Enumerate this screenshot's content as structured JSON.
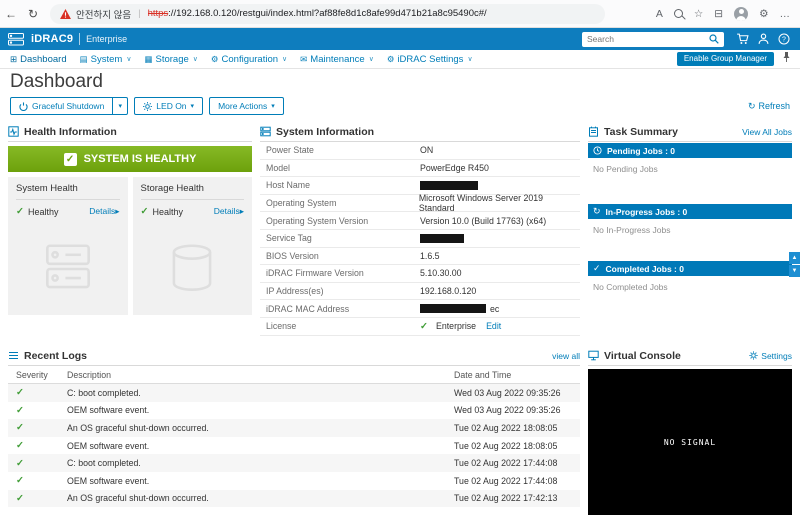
{
  "colors": {
    "accent": "#007db8",
    "header_blue": "#0e7dbe",
    "health_green": "#76aa17",
    "job_bar_blue": "#0079b8"
  },
  "glyphs": {
    "back": "←",
    "reload": "↻",
    "caret": "▾",
    "chevron": "∨",
    "check": "✓",
    "details_arrow": "▸",
    "refresh": "↻",
    "dashboard": "⊞",
    "system": "▤",
    "storage": "▦",
    "configuration": "⚙",
    "maintenance": "✉",
    "idrac_settings": "⚙",
    "scroll_up": "▲",
    "scroll_down": "▼"
  },
  "browser": {
    "warning_text": "안전하지 않음",
    "url_scheme": "https",
    "url_rest": "://192.168.0.120/restgui/index.html?af88fe8d1c8afe99d471b21a8c95490c#/",
    "right_icons": {
      "read_aloud": "A",
      "favorites": "☆",
      "collections": "⊟",
      "settings": "⚙",
      "more": "…"
    }
  },
  "header": {
    "product": "iDRAC9",
    "edition": "Enterprise",
    "search_placeholder": "Search"
  },
  "nav": {
    "items": [
      {
        "label": "Dashboard"
      },
      {
        "label": "System"
      },
      {
        "label": "Storage"
      },
      {
        "label": "Configuration"
      },
      {
        "label": "Maintenance"
      },
      {
        "label": "iDRAC Settings"
      }
    ],
    "group_manager_label": "Enable Group Manager"
  },
  "page": {
    "title": "Dashboard",
    "refresh_label": "Refresh"
  },
  "actions": {
    "graceful_shutdown": "Graceful Shutdown",
    "led": "LED On",
    "more_actions": "More Actions"
  },
  "health": {
    "panel_title": "Health Information",
    "banner": "SYSTEM IS HEALTHY",
    "cards": [
      {
        "title": "System Health",
        "status": "Healthy",
        "details_label": "Details"
      },
      {
        "title": "Storage Health",
        "status": "Healthy",
        "details_label": "Details"
      }
    ]
  },
  "system_info": {
    "panel_title": "System Information",
    "rows": [
      {
        "label": "Power State",
        "value": "ON"
      },
      {
        "label": "Model",
        "value": "PowerEdge R450"
      },
      {
        "label": "Host Name",
        "value": "",
        "redacted": true
      },
      {
        "label": "Operating System",
        "value": "Microsoft Windows Server 2019 Standard"
      },
      {
        "label": "Operating System Version",
        "value": "Version 10.0 (Build 17763) (x64)"
      },
      {
        "label": "Service Tag",
        "value": "",
        "redacted": true
      },
      {
        "label": "BIOS Version",
        "value": "1.6.5"
      },
      {
        "label": "iDRAC Firmware Version",
        "value": "5.10.30.00"
      },
      {
        "label": "IP Address(es)",
        "value": "192.168.0.120"
      },
      {
        "label": "iDRAC MAC Address",
        "value": "",
        "redacted": true,
        "suffix": "ec"
      },
      {
        "label": "License",
        "value": "Enterprise",
        "edit_label": "Edit"
      }
    ]
  },
  "tasks": {
    "panel_title": "Task Summary",
    "view_all_label": "View All Jobs",
    "sections": [
      {
        "title": "Pending Jobs : 0",
        "empty": "No Pending Jobs"
      },
      {
        "title": "In-Progress Jobs : 0",
        "empty": "No In-Progress Jobs"
      },
      {
        "title": "Completed Jobs : 0",
        "empty": "No Completed Jobs"
      }
    ]
  },
  "logs": {
    "panel_title": "Recent Logs",
    "view_all_label": "view all",
    "columns": [
      "Severity",
      "Description",
      "Date and Time"
    ],
    "rows": [
      {
        "description": "C: boot completed.",
        "datetime": "Wed 03 Aug 2022 09:35:26"
      },
      {
        "description": "OEM software event.",
        "datetime": "Wed 03 Aug 2022 09:35:26"
      },
      {
        "description": "An OS graceful shut-down occurred.",
        "datetime": "Tue 02 Aug 2022 18:08:05"
      },
      {
        "description": "OEM software event.",
        "datetime": "Tue 02 Aug 2022 18:08:05"
      },
      {
        "description": "C: boot completed.",
        "datetime": "Tue 02 Aug 2022 17:44:08"
      },
      {
        "description": "OEM software event.",
        "datetime": "Tue 02 Aug 2022 17:44:08"
      },
      {
        "description": "An OS graceful shut-down occurred.",
        "datetime": "Tue 02 Aug 2022 17:42:13"
      }
    ]
  },
  "console": {
    "panel_title": "Virtual Console",
    "settings_label": "Settings",
    "message": "NO SIGNAL"
  }
}
